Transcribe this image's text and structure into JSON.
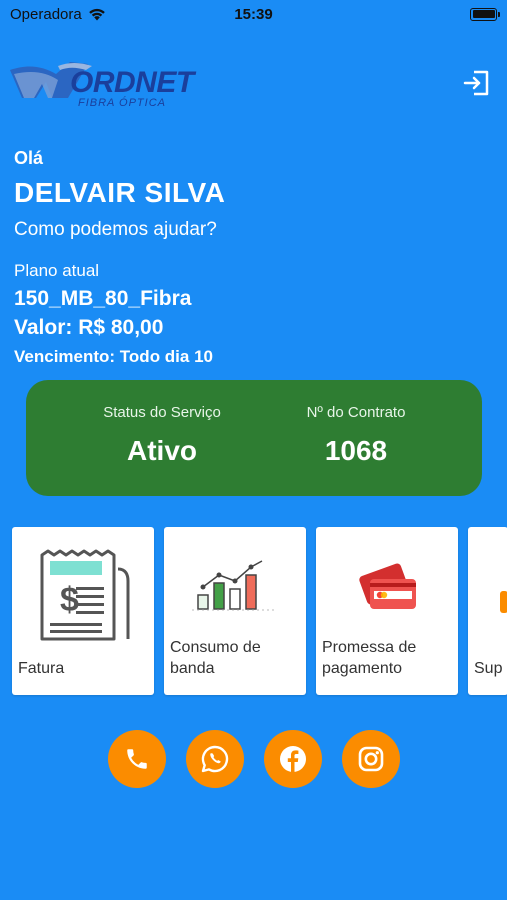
{
  "status_bar": {
    "carrier": "Operadora",
    "time": "15:39"
  },
  "brand": {
    "logo_text": "ORDNET",
    "logo_sub": "FIBRA ÓPTICA"
  },
  "user": {
    "greeting": "Olá",
    "name": "DELVAIR SILVA",
    "help": "Como podemos ajudar?"
  },
  "plan": {
    "label": "Plano atual",
    "name": "150_MB_80_Fibra",
    "value": "Valor: R$ 80,00",
    "due": "Vencimento: Todo dia 10"
  },
  "service": {
    "status_label": "Status do Serviço",
    "status_value": "Ativo",
    "contract_label": "Nº do Contrato",
    "contract_value": "1068"
  },
  "tiles": [
    {
      "label": "Fatura",
      "icon": "invoice-icon"
    },
    {
      "label": "Consumo de banda",
      "icon": "bandwidth-chart-icon"
    },
    {
      "label": "Promessa de pagamento",
      "icon": "credit-card-icon"
    },
    {
      "label": "Sup",
      "icon": "support-icon"
    }
  ],
  "social": [
    {
      "icon": "phone-icon"
    },
    {
      "icon": "whatsapp-icon"
    },
    {
      "icon": "facebook-icon"
    },
    {
      "icon": "instagram-icon"
    }
  ],
  "colors": {
    "background": "#1a8cf5",
    "status_card": "#2e7d32",
    "social_button": "#fb8c00",
    "logo": "#1a3f9c"
  }
}
